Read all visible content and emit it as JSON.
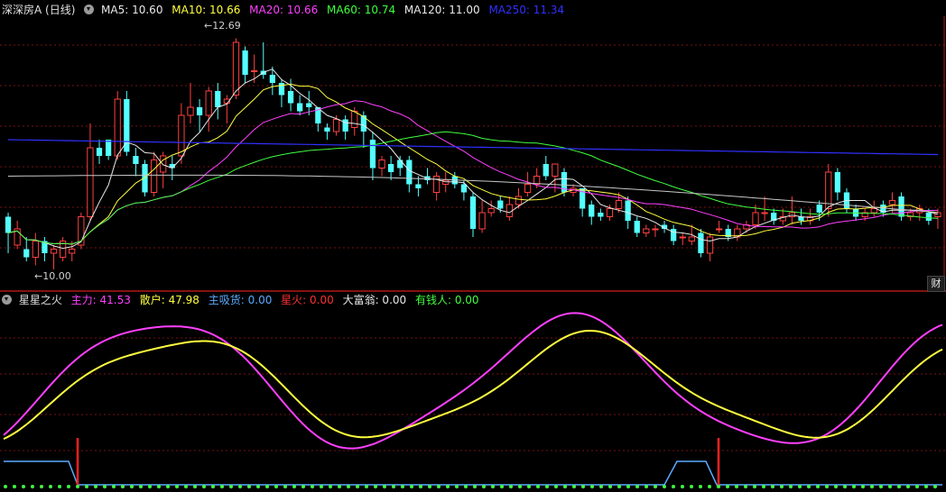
{
  "main_panel": {
    "title": "深深房A (日线)",
    "ma_items": [
      {
        "label": "MA5: 10.60",
        "color": "#e8e8e8"
      },
      {
        "label": "MA10: 10.66",
        "color": "#ffff40"
      },
      {
        "label": "MA20: 10.66",
        "color": "#ff40ff"
      },
      {
        "label": "MA60: 10.74",
        "color": "#40ff40"
      },
      {
        "label": "MA120: 11.00",
        "color": "#e8e8e8"
      },
      {
        "label": "MA250: 11.34",
        "color": "#4040ff"
      }
    ],
    "high_label": "12.69",
    "low_label": "10.00",
    "corner_button": "财"
  },
  "sub_panel": {
    "title": "星星之火",
    "items": [
      {
        "label": "主力: 41.53",
        "color": "#ff40ff"
      },
      {
        "label": "散户: 47.98",
        "color": "#ffff40"
      },
      {
        "label": "主吸货: 0.00",
        "color": "#5aaaff"
      },
      {
        "label": "星火: 0.00",
        "color": "#ff3030"
      },
      {
        "label": "大富翁: 0.00",
        "color": "#e8e8e8"
      },
      {
        "label": "有钱人: 0.00",
        "color": "#40ff40"
      }
    ]
  },
  "colors": {
    "up": "#ff4040",
    "down": "#54ffff",
    "grid": "#7a1010",
    "divider": "#b01818",
    "ma5": "#e8e8e8",
    "ma10": "#ffff40",
    "ma20": "#ff40ff",
    "ma60": "#40ff40",
    "ma120": "#c8c8c8",
    "ma250": "#3030ff"
  },
  "chart_data": {
    "type": "candlestick",
    "price_range": [
      9.8,
      13.0
    ],
    "candles": [
      [
        10.55,
        10.35,
        10.6,
        10.1
      ],
      [
        10.2,
        10.4,
        10.5,
        10.15
      ],
      [
        10.15,
        10.05,
        10.3,
        10.0
      ],
      [
        10.05,
        10.25,
        10.35,
        9.95
      ],
      [
        10.25,
        10.1,
        10.3,
        10.0
      ],
      [
        10.1,
        10.15,
        10.2,
        9.9
      ],
      [
        10.05,
        10.25,
        10.3,
        10.0
      ],
      [
        10.1,
        10.15,
        10.25,
        10.0
      ],
      [
        10.2,
        10.55,
        10.6,
        10.15
      ],
      [
        10.55,
        11.4,
        11.7,
        10.5
      ],
      [
        11.4,
        11.3,
        11.5,
        11.2
      ],
      [
        11.5,
        11.3,
        11.5,
        11.25
      ],
      [
        11.3,
        12.0,
        12.1,
        11.25
      ],
      [
        12.0,
        11.35,
        12.1,
        11.3
      ],
      [
        11.3,
        11.2,
        11.4,
        11.05
      ],
      [
        11.2,
        10.85,
        11.25,
        10.8
      ],
      [
        10.85,
        11.25,
        11.35,
        10.8
      ],
      [
        11.1,
        11.3,
        11.35,
        10.9
      ],
      [
        11.2,
        11.15,
        11.3,
        11.0
      ],
      [
        11.3,
        11.8,
        11.95,
        11.2
      ],
      [
        11.8,
        11.9,
        12.2,
        11.7
      ],
      [
        11.9,
        11.8,
        12.0,
        11.6
      ],
      [
        11.8,
        12.1,
        12.15,
        11.6
      ],
      [
        12.1,
        11.9,
        12.2,
        11.75
      ],
      [
        11.95,
        12.0,
        12.05,
        11.7
      ],
      [
        12.05,
        12.7,
        12.75,
        12.0
      ],
      [
        12.6,
        12.3,
        12.65,
        12.2
      ],
      [
        12.35,
        12.35,
        12.55,
        12.2
      ],
      [
        12.35,
        12.3,
        12.7,
        12.25
      ],
      [
        12.3,
        12.2,
        12.4,
        12.05
      ],
      [
        12.2,
        12.05,
        12.25,
        11.9
      ],
      [
        12.1,
        11.95,
        12.25,
        11.85
      ],
      [
        11.95,
        11.85,
        12.05,
        11.8
      ],
      [
        11.95,
        11.9,
        12.1,
        11.8
      ],
      [
        11.9,
        11.7,
        11.9,
        11.6
      ],
      [
        11.65,
        11.6,
        11.7,
        11.5
      ],
      [
        11.6,
        11.75,
        11.8,
        11.55
      ],
      [
        11.75,
        11.6,
        11.8,
        11.5
      ],
      [
        11.65,
        11.85,
        11.9,
        11.55
      ],
      [
        11.8,
        11.6,
        11.85,
        11.4
      ],
      [
        11.5,
        11.15,
        11.6,
        11.0
      ],
      [
        11.15,
        11.25,
        11.3,
        11.05
      ],
      [
        11.2,
        11.1,
        11.3,
        11.0
      ],
      [
        11.25,
        11.15,
        11.3,
        11.05
      ],
      [
        11.25,
        10.95,
        11.3,
        10.85
      ],
      [
        10.95,
        10.9,
        11.05,
        10.8
      ],
      [
        11.05,
        11.0,
        11.15,
        10.95
      ],
      [
        10.85,
        11.05,
        11.1,
        10.75
      ],
      [
        10.95,
        11.0,
        11.1,
        10.85
      ],
      [
        11.05,
        10.95,
        11.1,
        10.9
      ],
      [
        10.95,
        10.85,
        11.0,
        10.75
      ],
      [
        10.8,
        10.4,
        10.85,
        10.3
      ],
      [
        10.4,
        10.6,
        10.75,
        10.35
      ],
      [
        10.6,
        10.65,
        10.75,
        10.55
      ],
      [
        10.75,
        10.65,
        10.8,
        10.6
      ],
      [
        10.55,
        10.7,
        10.8,
        10.5
      ],
      [
        10.7,
        10.8,
        10.9,
        10.65
      ],
      [
        10.85,
        10.95,
        11.1,
        10.8
      ],
      [
        10.95,
        11.05,
        11.15,
        10.9
      ],
      [
        11.2,
        11.05,
        11.3,
        11.0
      ],
      [
        11.05,
        11.2,
        11.2,
        10.85
      ],
      [
        11.1,
        10.85,
        11.15,
        10.8
      ],
      [
        10.85,
        10.9,
        10.95,
        10.8
      ],
      [
        10.9,
        10.65,
        10.9,
        10.55
      ],
      [
        10.7,
        10.55,
        10.75,
        10.45
      ],
      [
        10.6,
        10.55,
        10.65,
        10.5
      ],
      [
        10.55,
        10.65,
        10.7,
        10.5
      ],
      [
        10.65,
        10.75,
        10.85,
        10.6
      ],
      [
        10.75,
        10.5,
        10.8,
        10.4
      ],
      [
        10.5,
        10.35,
        10.55,
        10.3
      ],
      [
        10.35,
        10.4,
        10.45,
        10.3
      ],
      [
        10.4,
        10.4,
        10.45,
        10.3
      ],
      [
        10.45,
        10.4,
        10.5,
        10.35
      ],
      [
        10.4,
        10.25,
        10.45,
        10.2
      ],
      [
        10.3,
        10.3,
        10.35,
        10.2
      ],
      [
        10.25,
        10.3,
        10.45,
        10.2
      ],
      [
        10.35,
        10.1,
        10.4,
        10.05
      ],
      [
        10.1,
        10.3,
        10.35,
        10.0
      ],
      [
        10.4,
        10.4,
        10.5,
        10.35
      ],
      [
        10.4,
        10.3,
        10.45,
        10.25
      ],
      [
        10.3,
        10.4,
        10.45,
        10.25
      ],
      [
        10.4,
        10.45,
        10.5,
        10.35
      ],
      [
        10.45,
        10.6,
        10.7,
        10.4
      ],
      [
        10.6,
        10.6,
        10.8,
        10.5
      ],
      [
        10.6,
        10.5,
        10.65,
        10.45
      ],
      [
        10.5,
        10.55,
        10.65,
        10.45
      ],
      [
        10.55,
        10.6,
        10.8,
        10.45
      ],
      [
        10.55,
        10.5,
        10.65,
        10.45
      ],
      [
        10.5,
        10.55,
        10.65,
        10.45
      ],
      [
        10.7,
        10.6,
        10.75,
        10.5
      ],
      [
        10.65,
        11.1,
        11.2,
        10.55
      ],
      [
        11.1,
        10.85,
        11.15,
        10.75
      ],
      [
        10.85,
        10.65,
        10.9,
        10.6
      ],
      [
        10.65,
        10.55,
        10.7,
        10.5
      ],
      [
        10.55,
        10.6,
        10.65,
        10.5
      ],
      [
        10.6,
        10.65,
        10.75,
        10.55
      ],
      [
        10.7,
        10.6,
        10.75,
        10.55
      ],
      [
        10.7,
        10.75,
        10.85,
        10.6
      ],
      [
        10.8,
        10.55,
        10.85,
        10.5
      ],
      [
        10.55,
        10.6,
        10.65,
        10.5
      ],
      [
        10.6,
        10.65,
        10.7,
        10.5
      ],
      [
        10.6,
        10.5,
        10.65,
        10.45
      ],
      [
        10.55,
        10.6,
        10.65,
        10.4
      ]
    ]
  }
}
